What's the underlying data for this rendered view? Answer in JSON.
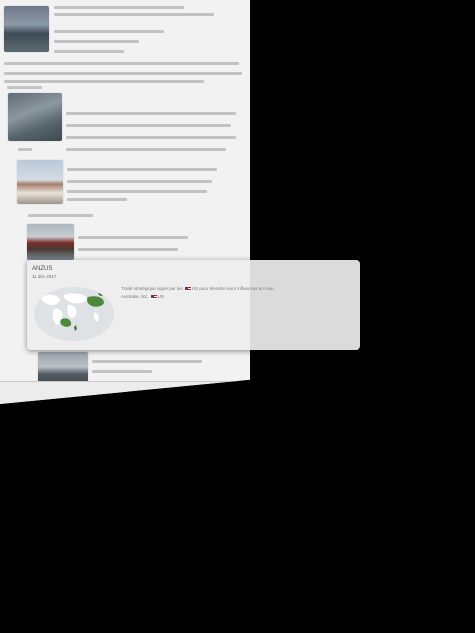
{
  "card": {
    "title": "ANZUS",
    "date": "11 déc 2017",
    "description_parts": [
      "Traité stratégique signé par les",
      "US",
      "pour étendre leurs influences en Asie."
    ],
    "members_prefix": "Australie, NZ,",
    "members_suffix": "US",
    "colors": {
      "background": "#eeeeee",
      "map_land": "#4a8a3a",
      "map_highlight": "#3d7a2f"
    }
  },
  "page": {
    "background": "#f2f2f2"
  }
}
